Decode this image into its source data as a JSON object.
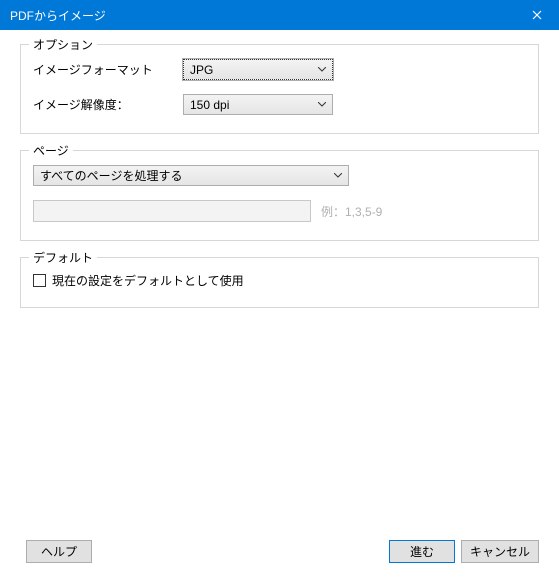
{
  "titlebar": {
    "title": "PDFからイメージ"
  },
  "options": {
    "group_label": "オプション",
    "format_label": "イメージフォーマット",
    "format_value": "JPG",
    "dpi_label": "イメージ解像度：",
    "dpi_value": "150 dpi"
  },
  "pages": {
    "group_label": "ページ",
    "mode_value": "すべてのページを処理する",
    "range_value": "",
    "hint": "例：1,3,5-9"
  },
  "defaults": {
    "group_label": "デフォルト",
    "checkbox_label": "現在の設定をデフォルトとして使用"
  },
  "buttons": {
    "help": "ヘルプ",
    "ok": "進む",
    "cancel": "キャンセル"
  }
}
